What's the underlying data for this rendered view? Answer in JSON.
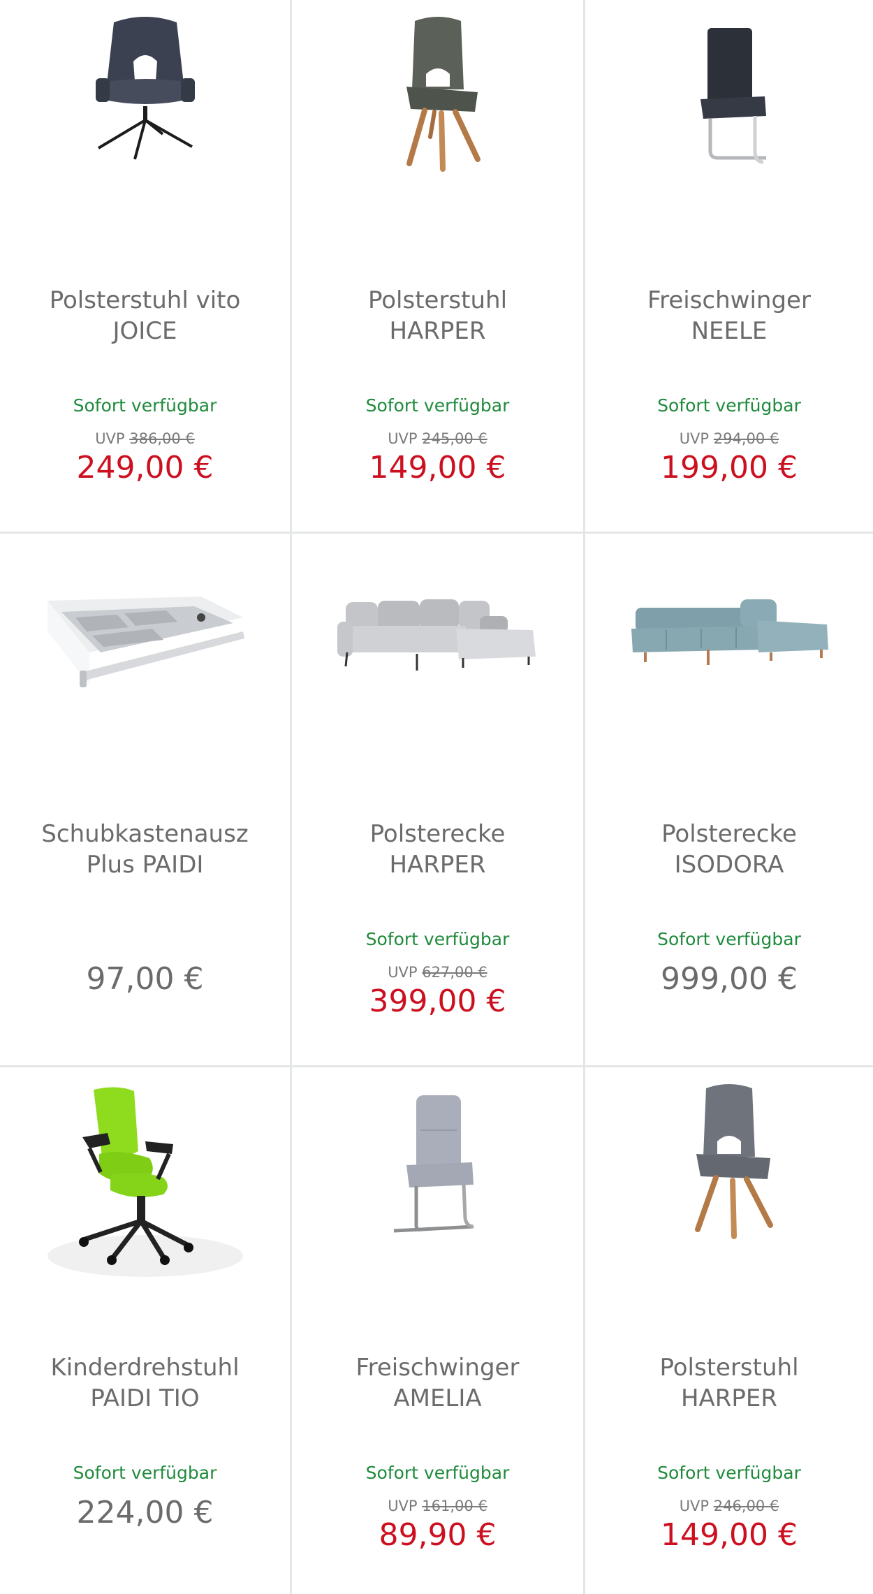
{
  "products": [
    {
      "title_line1": "Polsterstuhl vito",
      "title_line2": "JOICE",
      "availability": "Sofort verfügbar",
      "uvp_label": "UVP",
      "uvp_price": "386,00 €",
      "price": "249,00 €",
      "image_icon": "armchair-swivel-image"
    },
    {
      "title_line1": "Polsterstuhl",
      "title_line2": "HARPER",
      "availability": "Sofort verfügbar",
      "uvp_label": "UVP",
      "uvp_price": "245,00 €",
      "price": "149,00 €",
      "image_icon": "chair-wood-legs-image"
    },
    {
      "title_line1": "Freischwinger",
      "title_line2": "NEELE",
      "availability": "Sofort verfügbar",
      "uvp_label": "UVP",
      "uvp_price": "294,00 €",
      "price": "199,00 €",
      "image_icon": "cantilever-chair-image"
    },
    {
      "title_line1": "Schubkastenausz",
      "title_line2": "Plus PAIDI",
      "price": "97,00 €",
      "image_icon": "drawer-image"
    },
    {
      "title_line1": "Polsterecke",
      "title_line2": "HARPER",
      "availability": "Sofort verfügbar",
      "uvp_label": "UVP",
      "uvp_price": "627,00 €",
      "price": "399,00 €",
      "image_icon": "corner-sofa-image"
    },
    {
      "title_line1": "Polsterecke",
      "title_line2": "ISODORA",
      "availability": "Sofort verfügbar",
      "price": "999,00 €",
      "image_icon": "corner-sofa-image"
    },
    {
      "title_line1": "Kinderdrehstuhl",
      "title_line2": "PAIDI TIO",
      "availability": "Sofort verfügbar",
      "price": "224,00 €",
      "image_icon": "office-chair-image"
    },
    {
      "title_line1": "Freischwinger",
      "title_line2": "AMELIA",
      "availability": "Sofort verfügbar",
      "uvp_label": "UVP",
      "uvp_price": "161,00 €",
      "price": "89,90 €",
      "image_icon": "cantilever-chair-image"
    },
    {
      "title_line1": "Polsterstuhl",
      "title_line2": "HARPER",
      "availability": "Sofort verfügbar",
      "uvp_label": "UVP",
      "uvp_price": "246,00 €",
      "price": "149,00 €",
      "image_icon": "chair-wood-legs-image"
    }
  ],
  "colors": {
    "availability_green": "#1f8a3c",
    "sale_red": "#cc1020",
    "text_gray": "#6b6b6b",
    "divider": "#e4e6e7"
  }
}
